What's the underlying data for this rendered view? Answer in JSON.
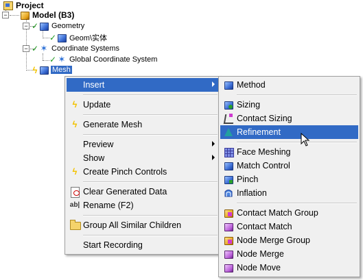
{
  "tree": {
    "project": "Project",
    "model": "Model (B3)",
    "geometry": "Geometry",
    "geom_body": "Geom\\实体",
    "coord_systems": "Coordinate Systems",
    "global_coord": "Global Coordinate System",
    "mesh": "Mesh"
  },
  "context_menu": {
    "insert": "Insert",
    "update": "Update",
    "generate_mesh": "Generate Mesh",
    "preview": "Preview",
    "show": "Show",
    "create_pinch": "Create Pinch Controls",
    "clear_data": "Clear Generated Data",
    "rename": "Rename (F2)",
    "group_children": "Group All Similar Children",
    "start_recording": "Start Recording"
  },
  "insert_submenu": {
    "method": "Method",
    "sizing": "Sizing",
    "contact_sizing": "Contact Sizing",
    "refinement": "Refinement",
    "face_meshing": "Face Meshing",
    "match_control": "Match Control",
    "pinch": "Pinch",
    "inflation": "Inflation",
    "contact_match_group": "Contact Match Group",
    "contact_match": "Contact Match",
    "node_merge_group": "Node Merge Group",
    "node_merge": "Node Merge",
    "node_move": "Node Move"
  },
  "colors": {
    "highlight": "#316ac5",
    "menu_bg": "#f0f0f0",
    "check_green": "#1f9a1f",
    "bolt_yellow": "#f2c200"
  }
}
